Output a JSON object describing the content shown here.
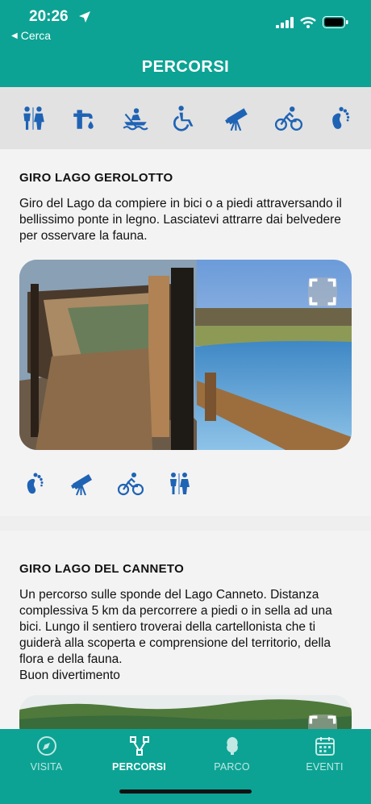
{
  "status": {
    "time": "20:26",
    "back_label": "Cerca"
  },
  "header": {
    "title": "PERCORSI"
  },
  "filters": [
    {
      "icon": "restroom-icon"
    },
    {
      "icon": "water-fountain-icon"
    },
    {
      "icon": "kayak-icon"
    },
    {
      "icon": "wheelchair-icon"
    },
    {
      "icon": "telescope-icon"
    },
    {
      "icon": "bicycle-icon"
    },
    {
      "icon": "footprint-icon"
    }
  ],
  "routes": [
    {
      "title": "GIRO LAGO GEROLOTTO",
      "description": "Giro del Lago da compiere in bici o a piedi attraversando il bellissimo ponte in legno. Lasciatevi attrarre dai belvedere per osservare la fauna.",
      "features": [
        "footprint-icon",
        "telescope-icon",
        "bicycle-icon",
        "restroom-icon"
      ]
    },
    {
      "title": "GIRO LAGO DEL CANNETO",
      "description": "Un percorso sulle sponde del Lago Canneto. Distanza complessiva 5 km da percorrere a piedi o in sella ad una bici. Lungo il sentiero troverai della cartellonista che ti guiderà alla scoperta e comprensione del territorio, della flora e della fauna.\nBuon divertimento"
    }
  ],
  "tabs": [
    {
      "label": "VISITA",
      "icon": "compass-icon",
      "active": false
    },
    {
      "label": "PERCORSI",
      "icon": "route-icon",
      "active": true
    },
    {
      "label": "PARCO",
      "icon": "tree-icon",
      "active": false
    },
    {
      "label": "EVENTI",
      "icon": "calendar-icon",
      "active": false
    }
  ],
  "colors": {
    "primary": "#0ca394",
    "icon_blue": "#1f63b4"
  }
}
